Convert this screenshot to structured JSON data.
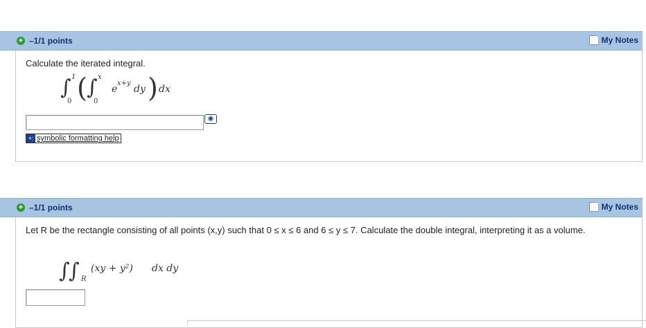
{
  "q1": {
    "number": ".",
    "points": "–1/1 points",
    "notes_label": "My Notes",
    "prompt": "Calculate the iterated integral.",
    "math": {
      "outer_upper": "1",
      "outer_lower": "0",
      "inner_upper": "x",
      "inner_lower": "0",
      "integrand": "e",
      "exponent": "x+y",
      "inner_d": "dy",
      "outer_d": "dx"
    },
    "answer_value": "",
    "preview_icon": "eye-icon",
    "help_label": "symbolic formatting help"
  },
  "q2": {
    "number": ".",
    "points": "–1/1 points",
    "notes_label": "My Notes",
    "prompt": "Let R be the rectangle consisting of all points (x,y) such that 0 ≤ x ≤ 6 and 6 ≤ y ≤ 7. Calculate the double integral, interpreting it as a volume.",
    "math": {
      "region": "R",
      "integrand": "(xy + y²)",
      "d": "dx dy"
    },
    "answer_value": ""
  }
}
